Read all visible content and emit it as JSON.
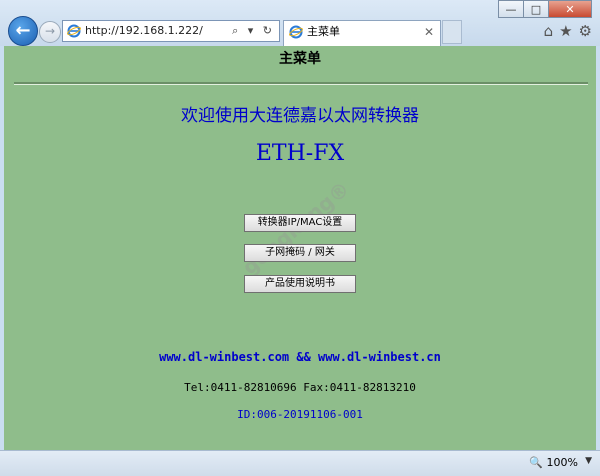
{
  "browser": {
    "address_url": "http://192.168.1.222/",
    "address_tools": "⌕ ▾ ↻",
    "tab_title": "主菜单",
    "tab_close": "✕",
    "win_min": "—",
    "win_max": "□",
    "win_close": "✕",
    "home_icon": "⌂",
    "fav_icon": "★",
    "gear_icon": "⚙",
    "back": "←",
    "forward": "→"
  },
  "page": {
    "title": "主菜单",
    "welcome": "欢迎使用大连德嘉以太网转换器",
    "product": "ETH-FX",
    "buttons": [
      {
        "label": "转换器IP/MAC设置"
      },
      {
        "label": "子网掩码 / 网关"
      },
      {
        "label": "产品使用说明书"
      }
    ],
    "links": "www.dl-winbest.com && www.dl-winbest.cn",
    "contact": "Tel:0411-82810696 Fax:0411-82813210",
    "device_id": "ID:006-20191106-001",
    "watermark": "gongkong®"
  },
  "status": {
    "zoom": "100%",
    "zoom_arrow": "▼"
  },
  "colors": {
    "page_bg": "#8fbd8b",
    "link_blue": "#0000cc"
  }
}
